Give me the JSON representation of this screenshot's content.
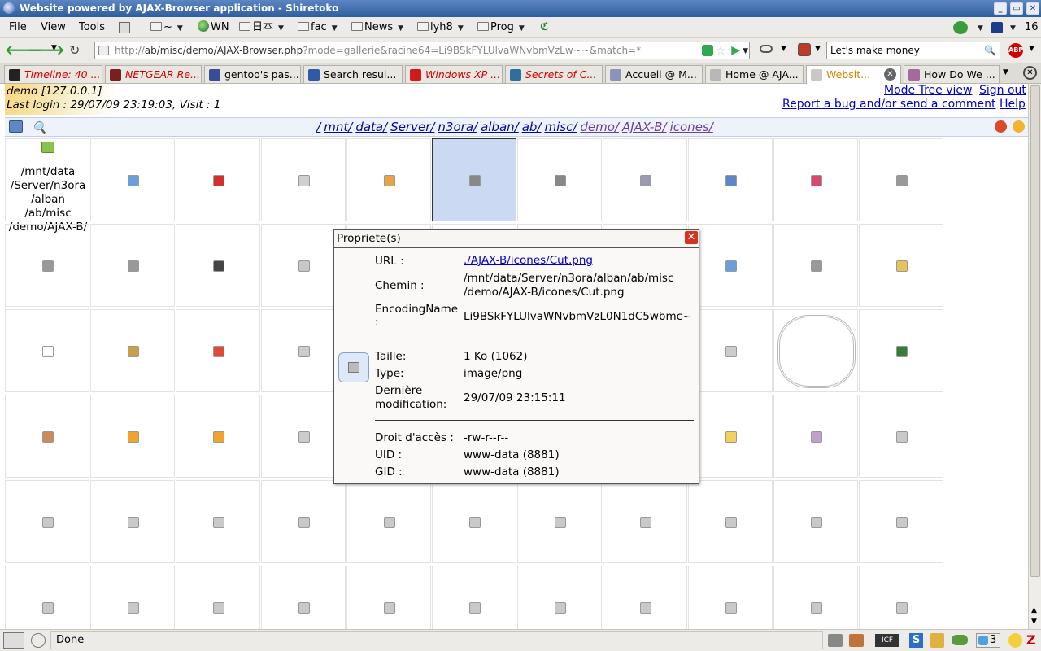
{
  "window": {
    "title": "Website powered by AJAX-Browser application - Shiretoko"
  },
  "menu": [
    "File",
    "View",
    "Tools"
  ],
  "bookmarks": {
    "home": "~",
    "wn": "WN",
    "nihon": "日本",
    "fac": "fac",
    "news": "News",
    "lyh8": "lyh8",
    "prog": "Prog",
    "count": "16"
  },
  "url": {
    "prefix": "http://",
    "bold1": "ab",
    "mid1": "/misc/demo/AJAX-Browser.php",
    "rest": "?mode=gallerie&racine64=Li9BSkFYLUlvaWNvbmVzLw~~&match=*"
  },
  "search": {
    "value": "Let's make money"
  },
  "tabs": [
    {
      "label": "Timeline: 40 ...",
      "color": "#222",
      "fg": "#d40000"
    },
    {
      "label": "NETGEAR Re...",
      "color": "#7a1f1f",
      "fg": "#d40000"
    },
    {
      "label": "gentoo's pas...",
      "color": "#3a4b99",
      "fg": "#000"
    },
    {
      "label": "Search resul...",
      "color": "#2f5aa8",
      "fg": "#000"
    },
    {
      "label": "Windows XP ...",
      "color": "#d21a1a",
      "fg": "#d40000"
    },
    {
      "label": "Secrets of C...",
      "color": "#2e6f9e",
      "fg": "#d40000"
    },
    {
      "label": "Accueil @ M...",
      "color": "#8a94b8",
      "fg": "#000"
    },
    {
      "label": "Home @ AJA...",
      "color": "#b8b8b8",
      "fg": "#000"
    },
    {
      "label": "Websit...",
      "color": "#c8c8c8",
      "fg": "#e07f00"
    },
    {
      "label": "How Do We ...",
      "color": "#a46aa0",
      "fg": "#000"
    }
  ],
  "user": {
    "line1": "demo [127.0.0.1]",
    "line2": "Last login : 29/07/09 23:19:03, Visit : 1"
  },
  "header_links": {
    "mode_tree": "Mode Tree view",
    "signout": "Sign out",
    "report": "Report a bug and/or send a comment",
    "help": "Help"
  },
  "path": [
    "/",
    "mnt/",
    "data/",
    "Server/",
    "n3ora/",
    "alban/",
    "ab/",
    "misc/",
    "demo/",
    "AJAX-B/",
    "icones/"
  ],
  "parent_label": [
    "/mnt/data",
    "/Server/n3ora",
    "/alban",
    "/ab/misc",
    "/demo/AJAX-B/"
  ],
  "colors": {
    "accent": "#000a9c",
    "selected": "#ccd9f3",
    "close": "#d8321f"
  },
  "popup": {
    "title": "Propriete(s)",
    "url_label": "URL :",
    "url_value": "./AJAX-B/icones/Cut.png",
    "chemin_label": "Chemin :",
    "chemin_value1": "/mnt/data/Server/n3ora/alban/ab/misc",
    "chemin_value2": "/demo/AJAX-B/icones/Cut.png",
    "enc_label1": "EncodingName",
    "enc_label2": ":",
    "enc_value": "Li9BSkFYLUlvaWNvbmVzL0N1dC5wbmc~",
    "taille_label": "Taille:",
    "taille_value": "1 Ko (1062)",
    "type_label": "Type:",
    "type_value": "image/png",
    "modif_label1": "Dernière",
    "modif_label2": "modification:",
    "modif_value": "29/07/09 23:15:11",
    "droit_label": "Droit d'accès :",
    "droit_value": "-rw-r--r--",
    "uid_label": "UID :",
    "uid_value": "www-data (8881)",
    "gid_label": "GID :",
    "gid_value": "www-data (8881)"
  },
  "status": {
    "text": "Done",
    "count": "3"
  }
}
